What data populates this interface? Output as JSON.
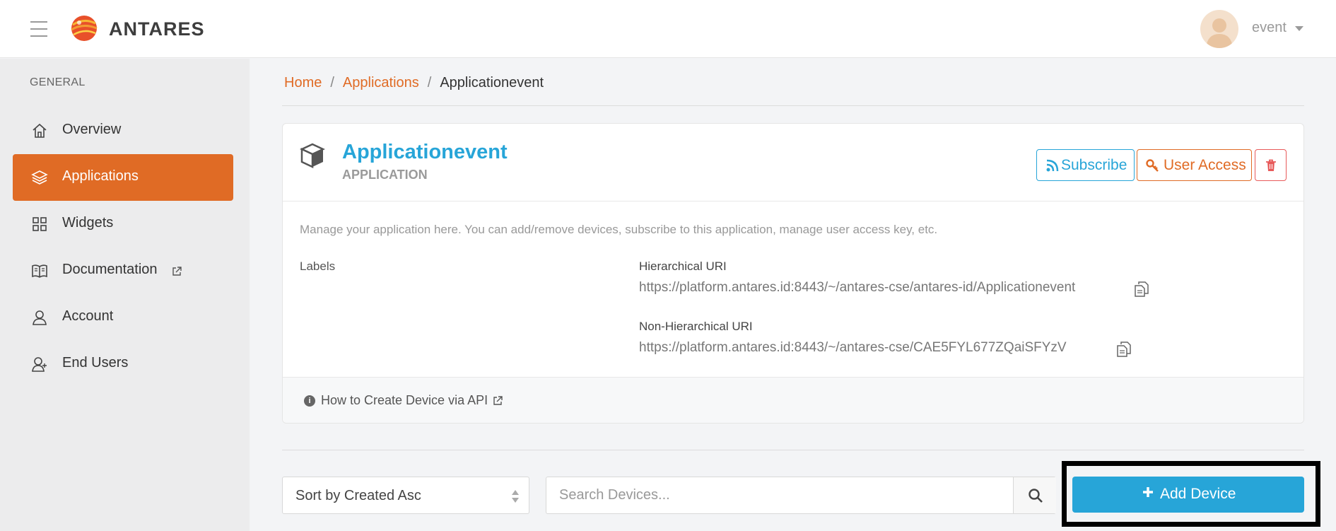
{
  "header": {
    "brand": "ANTARES",
    "user_name": "event"
  },
  "sidebar": {
    "heading": "GENERAL",
    "items": [
      {
        "label": "Overview",
        "icon": "home-icon",
        "active": false
      },
      {
        "label": "Applications",
        "icon": "layers-icon",
        "active": true
      },
      {
        "label": "Widgets",
        "icon": "grid-icon",
        "active": false
      },
      {
        "label": "Documentation",
        "icon": "book-icon",
        "active": false,
        "external": true
      },
      {
        "label": "Account",
        "icon": "user-icon",
        "active": false
      },
      {
        "label": "End Users",
        "icon": "users-icon",
        "active": false
      }
    ]
  },
  "breadcrumb": {
    "home": "Home",
    "applications": "Applications",
    "current": "Applicationevent",
    "separator": "/"
  },
  "app": {
    "title": "Applicationevent",
    "subtitle": "APPLICATION",
    "subscribe_label": "Subscribe",
    "user_access_label": "User Access",
    "description": "Manage your application here. You can add/remove devices, subscribe to this application, manage user access key, etc.",
    "labels_heading": "Labels",
    "hierarchical_uri_label": "Hierarchical URI",
    "hierarchical_uri": "https://platform.antares.id:8443/~/antares-cse/antares-id/Applicationevent",
    "non_hierarchical_uri_label": "Non-Hierarchical URI",
    "non_hierarchical_uri": "https://platform.antares.id:8443/~/antares-cse/CAE5FYL677ZQaiSFYzV",
    "api_link": "How to Create Device via API"
  },
  "toolbar": {
    "sort_value": "Sort by Created Asc",
    "search_placeholder": "Search Devices...",
    "add_device_label": "Add Device"
  },
  "colors": {
    "accent_orange": "#e06b25",
    "accent_blue": "#27a5d8",
    "danger_red": "#e85a5a"
  }
}
